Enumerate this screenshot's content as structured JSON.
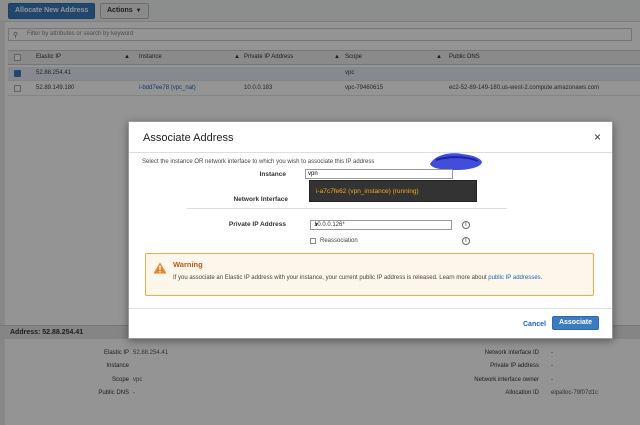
{
  "toolbar": {
    "allocate_label": "Allocate New Address",
    "actions_label": "Actions"
  },
  "filter": {
    "placeholder": "Filter by attributes or search by keyword"
  },
  "table": {
    "columns": [
      "Elastic IP",
      "Instance",
      "Private IP Address",
      "Scope",
      "Public DNS"
    ],
    "rows": [
      {
        "elastic_ip": "52.88.254.41",
        "instance": "",
        "private_ip": "",
        "scope": "vpc",
        "public_dns": "",
        "selected": true
      },
      {
        "elastic_ip": "52.89.149.180",
        "instance": "i-bdd7ee78 (vpc_nat)",
        "private_ip": "10.0.0.183",
        "scope": "vpc-79460615",
        "public_dns": "ec2-52-89-149-180.us-west-2.compute.amazonaws.com",
        "selected": false
      }
    ]
  },
  "details": {
    "header": "Address: 52.88.254.41",
    "left": [
      {
        "label": "Elastic IP",
        "value": "52.88.254.41"
      },
      {
        "label": "Instance",
        "value": ""
      },
      {
        "label": "Scope",
        "value": "vpc"
      },
      {
        "label": "Public DNS",
        "value": "-"
      }
    ],
    "right": [
      {
        "label": "Network interface ID",
        "value": "-"
      },
      {
        "label": "Private IP address",
        "value": "-"
      },
      {
        "label": "Network interface owner",
        "value": "-"
      },
      {
        "label": "Allocation ID",
        "value": "eipalloc-79f07d1c"
      }
    ]
  },
  "modal": {
    "title": "Associate Address",
    "close": "×",
    "description": "Select the instance OR network interface to which you wish to associate this IP address",
    "instance_label": "Instance",
    "instance_value": "vpn",
    "instance_option": "i-a7c7fe62 (vpn_instance) (running)",
    "network_interface_label": "Network Interface",
    "private_ip_label": "Private IP Address",
    "private_ip_value": "10.0.0.126*",
    "reassociation_label": "Reassociation",
    "info": "i",
    "warning_title": "Warning",
    "warning_text": "If you associate an Elastic IP address with your instance, your current public IP address is released. Learn more about",
    "warning_link": "public IP addresses",
    "warning_end": ".",
    "cancel_label": "Cancel",
    "associate_label": "Associate"
  },
  "colors": {
    "primary": "#3b7bbf",
    "warning_border": "#f0a848",
    "warning_title": "#c05617",
    "dropdown_text": "#f5a623",
    "link": "#1e62b7"
  },
  "icons": {
    "search": "search-icon",
    "close": "close-icon",
    "warning": "warning-icon",
    "info": "info-icon"
  }
}
